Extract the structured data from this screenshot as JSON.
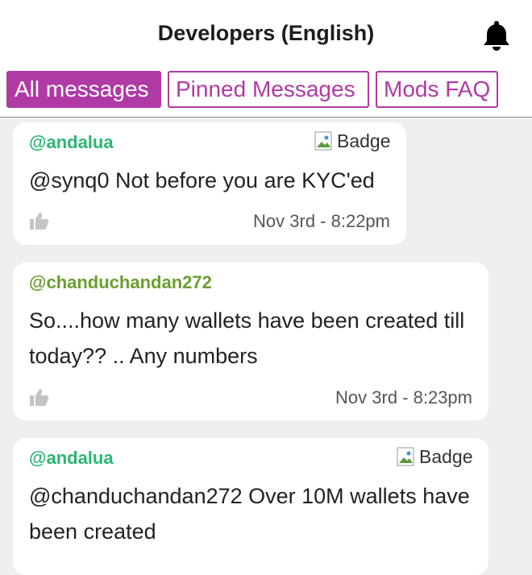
{
  "header": {
    "title": "Developers (English)",
    "bell_icon": "bell-icon"
  },
  "tabs": [
    {
      "label": "All messages",
      "active": true
    },
    {
      "label": "Pinned Messages",
      "active": false
    },
    {
      "label": "Mods FAQ",
      "active": false
    }
  ],
  "messages": [
    {
      "author": "@andalua",
      "author_color": "#2bb673",
      "badge": "Badge",
      "text": "@synq0 Not before you are KYC'ed",
      "time": "Nov 3rd - 8:22pm"
    },
    {
      "author": "@chanduchandan272",
      "author_color": "#6a9f2e",
      "badge": "",
      "text": "So....how many wallets have been created till today?? .. Any numbers",
      "time": "Nov 3rd - 8:23pm"
    },
    {
      "author": "@andalua",
      "author_color": "#2bb673",
      "badge": "Badge",
      "text": "@chanduchandan272 Over 10M wallets have been created",
      "time": ""
    }
  ],
  "colors": {
    "accent": "#b03aa5",
    "background": "#efefef"
  }
}
